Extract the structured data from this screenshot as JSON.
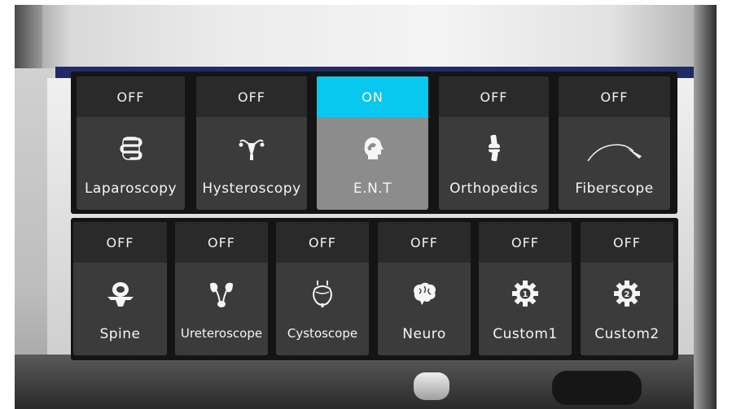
{
  "modes_row1": [
    {
      "status": "OFF",
      "label": "Laparoscopy",
      "icon": "intestine-icon",
      "active": false
    },
    {
      "status": "OFF",
      "label": "Hysteroscopy",
      "icon": "uterus-icon",
      "active": false
    },
    {
      "status": "ON",
      "label": "E.N.T",
      "icon": "head-profile-icon",
      "active": true
    },
    {
      "status": "OFF",
      "label": "Orthopedics",
      "icon": "knee-joint-icon",
      "active": false
    },
    {
      "status": "OFF",
      "label": "Fiberscope",
      "icon": "fiberscope-icon",
      "active": false
    }
  ],
  "modes_row2": [
    {
      "status": "OFF",
      "label": "Spine",
      "icon": "vertebra-icon",
      "active": false
    },
    {
      "status": "OFF",
      "label": "Ureteroscope",
      "icon": "kidneys-icon",
      "active": false
    },
    {
      "status": "OFF",
      "label": "Cystoscope",
      "icon": "bladder-icon",
      "active": false
    },
    {
      "status": "OFF",
      "label": "Neuro",
      "icon": "brain-icon",
      "active": false
    },
    {
      "status": "OFF",
      "label": "Custom1",
      "icon": "gear-1-icon",
      "active": false
    },
    {
      "status": "OFF",
      "label": "Custom2",
      "icon": "gear-2-icon",
      "active": false
    }
  ],
  "custom1_number": "1",
  "custom2_number": "2",
  "colors": {
    "on_accent": "#08c8f0",
    "tile_body": "#3b3b3b",
    "active_body": "#8c8c8c",
    "status_bg": "#2a2a2a"
  }
}
